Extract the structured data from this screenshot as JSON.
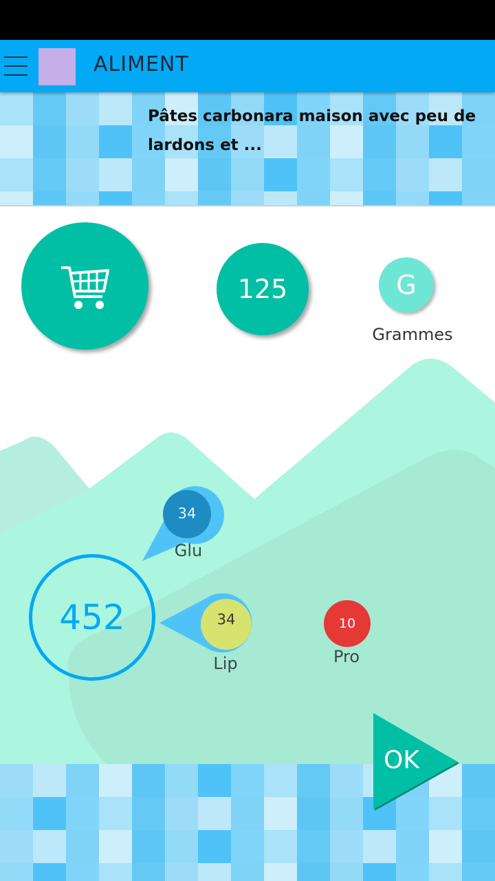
{
  "app": {
    "title": "ALIMENT"
  },
  "food": {
    "name": "Pâtes carbonara maison avec peu de lardons et ..."
  },
  "portion": {
    "quantity": "125",
    "unit_icon_letter": "G",
    "unit_label": "Grammes"
  },
  "energy": {
    "kcal": "452"
  },
  "macros": {
    "glu": {
      "label": "Glu",
      "value": "34",
      "color": "#1e8bc3"
    },
    "lip": {
      "label": "Lip",
      "value": "34",
      "color": "#d6e36f"
    },
    "pro": {
      "label": "Pro",
      "value": "10",
      "color": "#e53935"
    }
  },
  "actions": {
    "ok_label": "OK"
  },
  "icons": {
    "menu": "menu-icon",
    "cart": "cart-icon"
  },
  "colors": {
    "accent": "#03a9f4",
    "primary": "#00bfa5",
    "mountain": "#a8f0d8"
  }
}
